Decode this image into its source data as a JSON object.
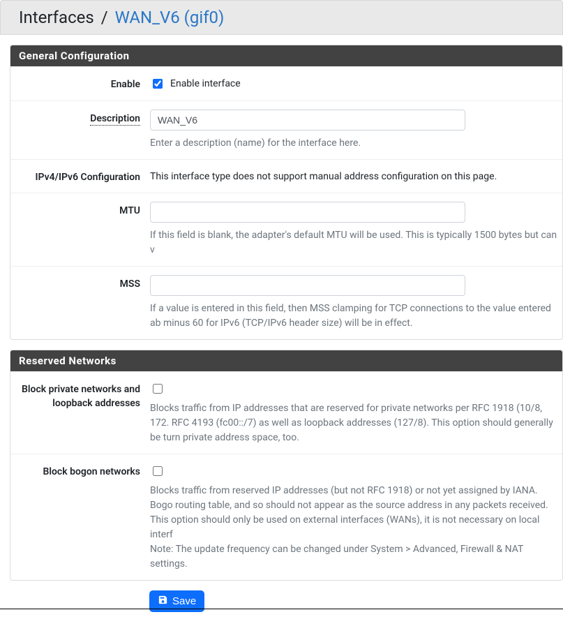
{
  "breadcrumb": {
    "root": "Interfaces",
    "separator": "/",
    "current": "WAN_V6 (gif0)"
  },
  "panels": {
    "general": {
      "title": "General Configuration",
      "enable": {
        "label": "Enable",
        "checkbox_label": "Enable interface",
        "checked": true
      },
      "description": {
        "label": "Description",
        "value": "WAN_V6",
        "help": "Enter a description (name) for the interface here."
      },
      "ipconfig": {
        "label": "IPv4/IPv6 Configuration",
        "text": "This interface type does not support manual address configuration on this page."
      },
      "mtu": {
        "label": "MTU",
        "value": "",
        "help": "If this field is blank, the adapter's default MTU will be used. This is typically 1500 bytes but can v"
      },
      "mss": {
        "label": "MSS",
        "value": "",
        "help": "If a value is entered in this field, then MSS clamping for TCP connections to the value entered ab minus 60 for IPv6 (TCP/IPv6 header size) will be in effect."
      }
    },
    "reserved": {
      "title": "Reserved Networks",
      "block_private": {
        "label": "Block private networks and loopback addresses",
        "checked": false,
        "help": "Blocks traffic from IP addresses that are reserved for private networks per RFC 1918 (10/8, 172. RFC 4193 (fc00::/7) as well as loopback addresses (127/8). This option should generally be turn private address space, too."
      },
      "block_bogon": {
        "label": "Block bogon networks",
        "checked": false,
        "help": "Blocks traffic from reserved IP addresses (but not RFC 1918) or not yet assigned by IANA. Bogo routing table, and so should not appear as the source address in any packets received.\nThis option should only be used on external interfaces (WANs), it is not necessary on local interf\nNote: The update frequency can be changed under System > Advanced, Firewall & NAT settings."
      }
    }
  },
  "actions": {
    "save": "Save"
  }
}
